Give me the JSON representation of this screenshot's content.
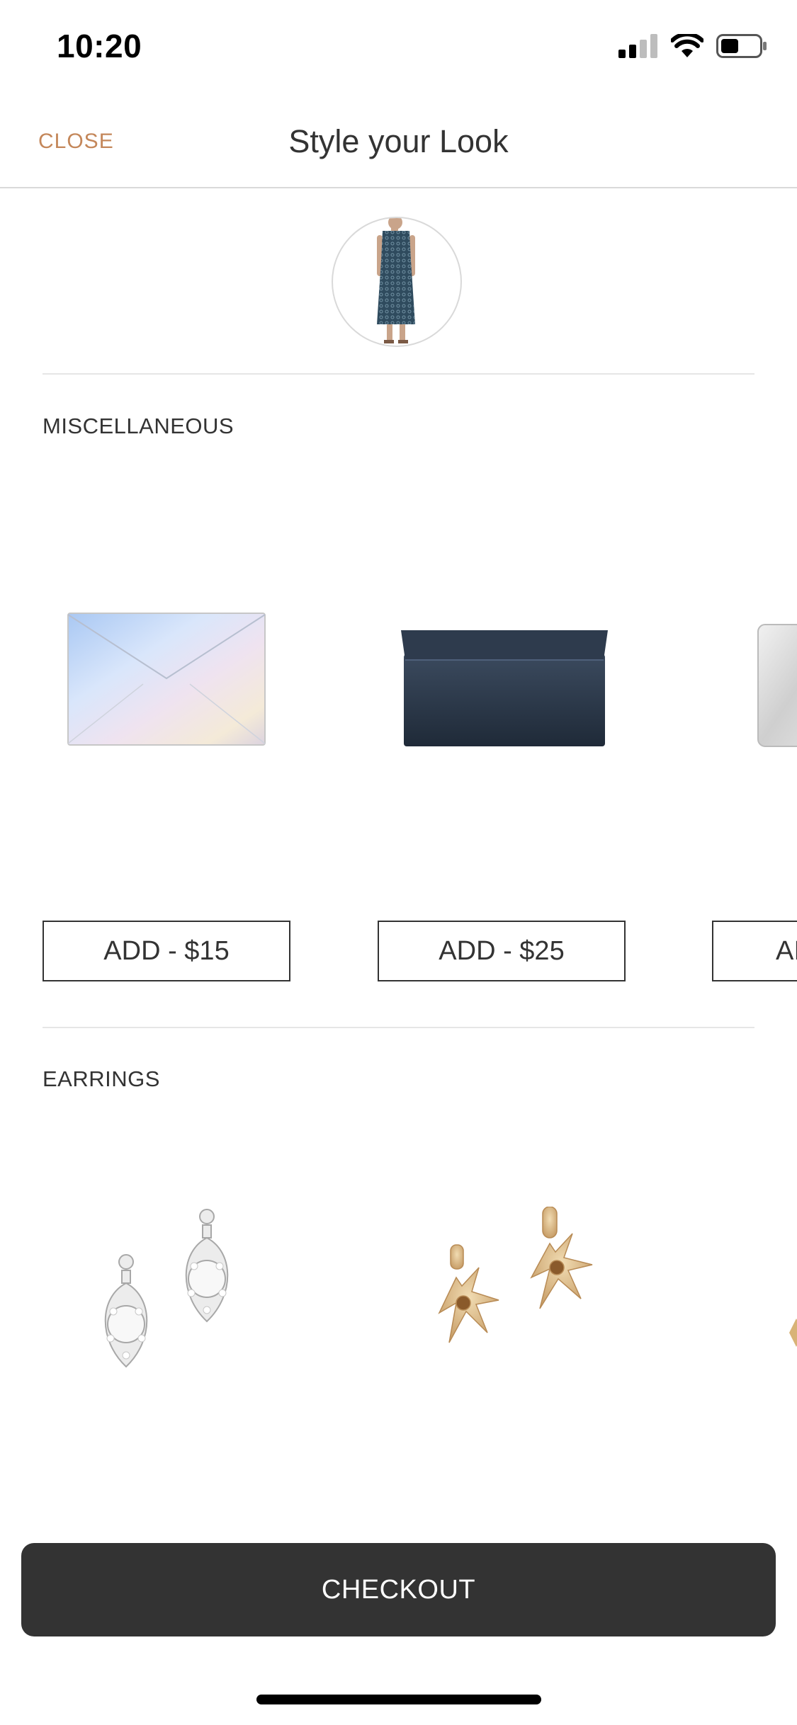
{
  "status_bar": {
    "time": "10:20",
    "icons": [
      "signal-icon",
      "wifi-icon",
      "battery-icon"
    ]
  },
  "nav": {
    "close_label": "CLOSE",
    "title": "Style your Look"
  },
  "look": {
    "image": "dress-thumbnail"
  },
  "sections": [
    {
      "label": "MISCELLANEOUS",
      "items": [
        {
          "image": "holographic-envelope-clutch",
          "button": "ADD - $15"
        },
        {
          "image": "navy-fold-clutch",
          "button": "ADD - $25"
        },
        {
          "image": "silver-clutch",
          "button": "AI"
        }
      ]
    },
    {
      "label": "EARRINGS",
      "items": [
        {
          "image": "crystal-drop-earrings"
        },
        {
          "image": "gold-flower-earrings"
        }
      ]
    }
  ],
  "checkout": {
    "label": "CHECKOUT"
  },
  "colors": {
    "accent": "#c4875a",
    "button_dark": "#333333",
    "divider": "#e6e6e6"
  }
}
